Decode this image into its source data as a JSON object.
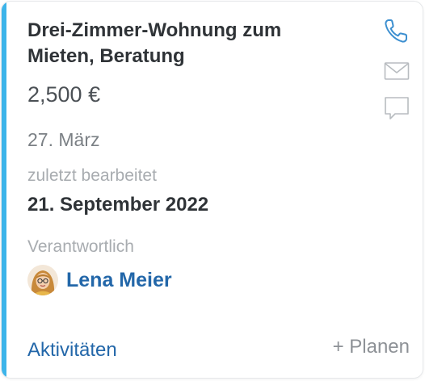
{
  "card": {
    "title": "Drei-Zimmer-Wohnung zum Mieten, Beratung",
    "price": "2,500 €",
    "date": "27. März",
    "edited_label": "zuletzt bearbeitet",
    "edited_value": "21. September 2022",
    "responsible_label": "Verantwortlich",
    "responsible_name": "Lena Meier",
    "activities_link": "Aktivitäten",
    "plan_button": "+ Planen"
  },
  "actions": [
    {
      "icon": "phone-icon",
      "active": true
    },
    {
      "icon": "mail-icon",
      "active": false
    },
    {
      "icon": "chat-icon",
      "active": false
    }
  ],
  "colors": {
    "accent": "#3cb4ea",
    "link": "#2367a9",
    "icon_active": "#3c8fd0",
    "icon_inactive": "#b8bcc0"
  }
}
